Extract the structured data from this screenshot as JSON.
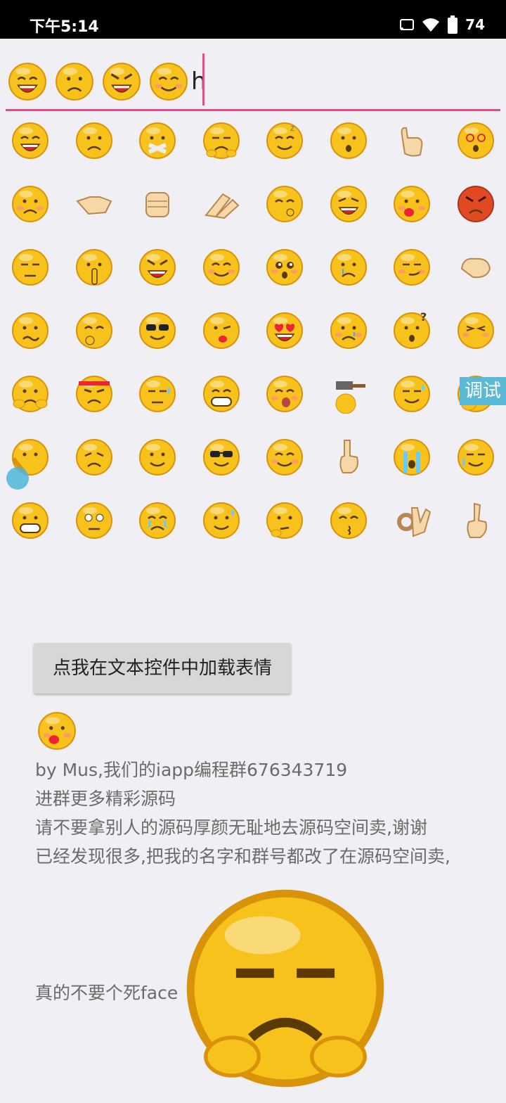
{
  "status_bar": {
    "time": "下午5:14",
    "battery": "74",
    "icons": [
      "cast-icon",
      "wifi-icon",
      "battery-icon"
    ]
  },
  "input": {
    "emojis": [
      "grin",
      "sad",
      "angry",
      "shy"
    ],
    "text": "h",
    "accent_color": "#e84c88"
  },
  "emoji_grid": [
    [
      "grin",
      "sad",
      "mute",
      "smug",
      "sleepy",
      "surprised",
      "victory",
      "dizzy"
    ],
    [
      "worried",
      "handshake",
      "fist",
      "clap",
      "shush",
      "laugh",
      "tongue",
      "furious"
    ],
    [
      "bored",
      "finger-quiet",
      "angry",
      "shy",
      "pleading",
      "tearing",
      "smirk",
      "bicep"
    ],
    [
      "confused",
      "think",
      "cool",
      "wink",
      "love",
      "crying-small",
      "question",
      "squint"
    ],
    [
      "hug",
      "ninja",
      "sweat",
      "grimace",
      "yawn",
      "hammer",
      "wipe-sweat",
      "yawn-hand"
    ],
    [
      "peek",
      "pout",
      "smile",
      "sunglasses",
      "squint-smile",
      "point-up",
      "cry",
      "snooty"
    ],
    [
      "big-grin",
      "stare",
      "weep",
      "sweat-smile",
      "thinking",
      "kiss",
      "ok",
      "index-up"
    ]
  ],
  "floating": {
    "debug_label": "调试"
  },
  "load_button_label": "点我在文本控件中加载表情",
  "result_emoji": "tongue",
  "info_lines": [
    "by Mus,我们的iapp编程群676343719",
    "进群更多精彩源码",
    "请不要拿别人的源码厚颜无耻地去源码空间卖,谢谢",
    "已经发现很多,把我的名字和群号都改了在源码空间卖,"
  ],
  "last_line_text": "真的不要个死face",
  "last_line_emoji": "smug",
  "colors": {
    "face": "#f7c21c",
    "face_edge": "#d9930a",
    "background": "#f0eff4"
  }
}
